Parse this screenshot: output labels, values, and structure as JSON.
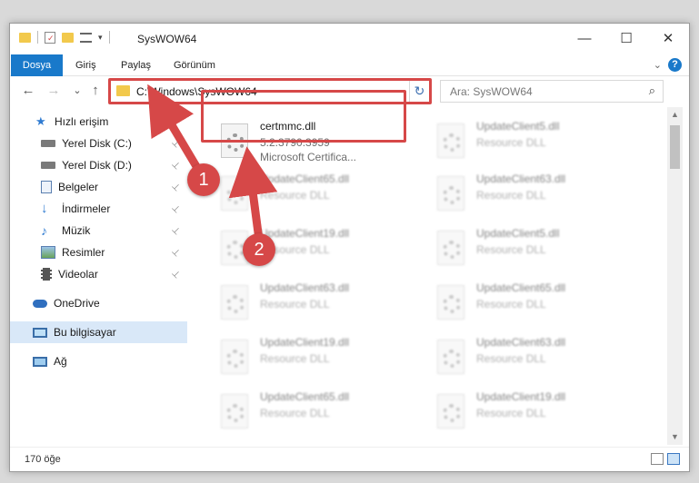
{
  "window": {
    "title": "SysWOW64",
    "minimize": "—",
    "maximize": "☐",
    "close": "✕"
  },
  "ribbon": {
    "tabs": [
      "Dosya",
      "Giriş",
      "Paylaş",
      "Görünüm"
    ],
    "expand": "⌄",
    "help": "?",
    "accent": "#1979ca"
  },
  "nav": {
    "back": "←",
    "forward": "→",
    "recent": "⌄",
    "up": "↑",
    "address": "C:\\Windows\\SysWOW64",
    "address_dropdown": "⌄",
    "refresh": "↻",
    "search_placeholder": "Ara: SysWOW64",
    "search_icon": "⌕"
  },
  "sidebar": {
    "items": [
      {
        "label": "Hızlı erişim",
        "icon": "star-icon",
        "pinned": false
      },
      {
        "label": "Yerel Disk (C:)",
        "icon": "drive-icon",
        "pinned": true
      },
      {
        "label": "Yerel Disk (D:)",
        "icon": "drive-icon",
        "pinned": true
      },
      {
        "label": "Belgeler",
        "icon": "documents-icon",
        "pinned": true
      },
      {
        "label": "İndirmeler",
        "icon": "download-icon",
        "pinned": true
      },
      {
        "label": "Müzik",
        "icon": "music-icon",
        "pinned": true
      },
      {
        "label": "Resimler",
        "icon": "pictures-icon",
        "pinned": true
      },
      {
        "label": "Videolar",
        "icon": "videos-icon",
        "pinned": true
      },
      {
        "label": "OneDrive",
        "icon": "cloud-icon",
        "pinned": false
      },
      {
        "label": "Bu bilgisayar",
        "icon": "computer-icon",
        "pinned": false,
        "selected": true
      },
      {
        "label": "Ağ",
        "icon": "network-icon",
        "pinned": false
      }
    ],
    "pin_glyph": "📌"
  },
  "files": [
    {
      "name": "certmmc.dll",
      "version": "5.2.3790.3959",
      "description": "Microsoft Certifica...",
      "highlighted": true
    },
    {
      "name": "UpdateClient5.dll",
      "description": "Resource DLL"
    },
    {
      "name": "UpdateClient65.dll",
      "description": "Resource DLL"
    },
    {
      "name": "UpdateClient63.dll",
      "description": "Resource DLL"
    },
    {
      "name": "UpdateClient19.dll",
      "description": "Resource DLL"
    },
    {
      "name": "UpdateClient5.dll",
      "description": "Resource DLL"
    },
    {
      "name": "UpdateClient63.dll",
      "description": "Resource DLL"
    },
    {
      "name": "UpdateClient65.dll",
      "description": "Resource DLL"
    },
    {
      "name": "UpdateClient19.dll",
      "description": "Resource DLL"
    },
    {
      "name": "UpdateClient63.dll",
      "description": "Resource DLL"
    },
    {
      "name": "UpdateClient65.dll",
      "description": "Resource DLL"
    },
    {
      "name": "UpdateClient19.dll",
      "description": "Resource DLL"
    }
  ],
  "status": {
    "count": "170 öğe"
  },
  "annotations": {
    "step1": "1",
    "step2": "2",
    "color": "#d64848"
  }
}
